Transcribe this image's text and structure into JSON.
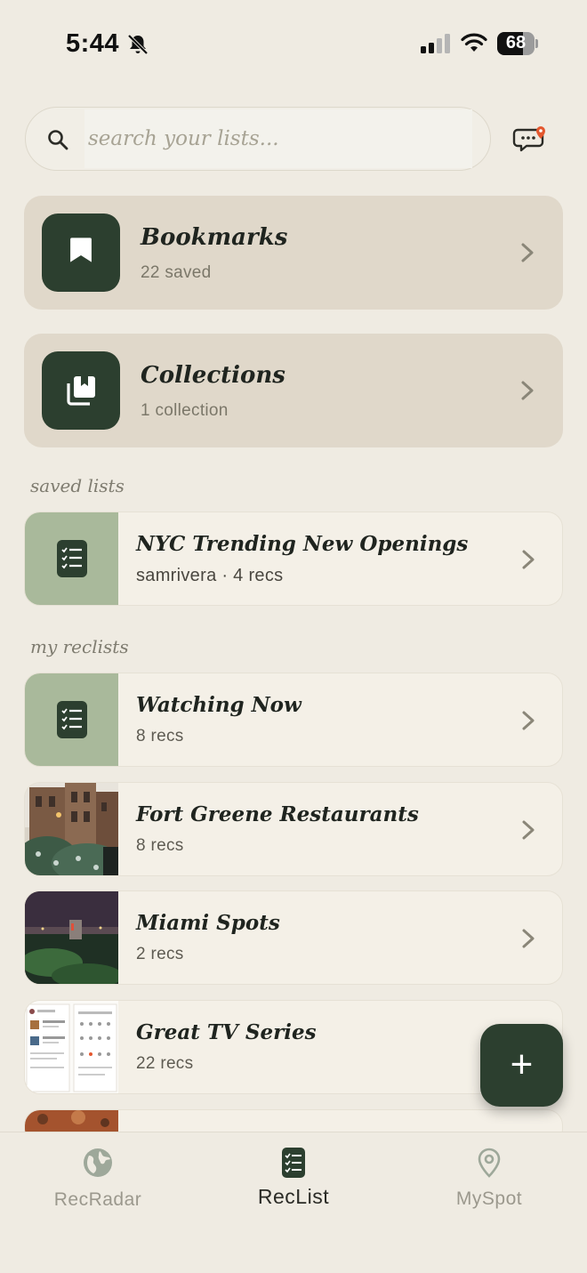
{
  "status_bar": {
    "time": "5:44",
    "battery": "68",
    "battery_level": 0.68
  },
  "search": {
    "placeholder": "search your lists..."
  },
  "cards": [
    {
      "title": "Bookmarks",
      "subtitle": "22 saved",
      "icon": "bookmark-icon"
    },
    {
      "title": "Collections",
      "subtitle": "1 collection",
      "icon": "collections-icon"
    }
  ],
  "sections": {
    "saved_lists": "saved lists",
    "my_reclists": "my reclists"
  },
  "saved_lists": [
    {
      "title": "NYC Trending New Openings",
      "subtitle": "samrivera · 4 recs"
    }
  ],
  "my_reclists": [
    {
      "title": "Watching Now",
      "subtitle": "8 recs",
      "thumb": "checklist-icon"
    },
    {
      "title": "Fort Greene Restaurants",
      "subtitle": "8 recs",
      "thumb": "photo-brownstones"
    },
    {
      "title": "Miami Spots",
      "subtitle": "2 recs",
      "thumb": "photo-night-water"
    },
    {
      "title": "Great TV Series",
      "subtitle": "22 recs",
      "thumb": "photo-screenshots"
    }
  ],
  "fab": {
    "label": "+"
  },
  "tabs": [
    {
      "label": "RecRadar",
      "icon": "globe-icon",
      "active": false
    },
    {
      "label": "RecList",
      "icon": "checklist-icon",
      "active": true
    },
    {
      "label": "MySpot",
      "icon": "location-pin-icon",
      "active": false
    }
  ],
  "colors": {
    "background": "#efebe2",
    "accent": "#2c3f2f",
    "card": "#e0d8ca",
    "green_thumb": "#a9b99b"
  }
}
